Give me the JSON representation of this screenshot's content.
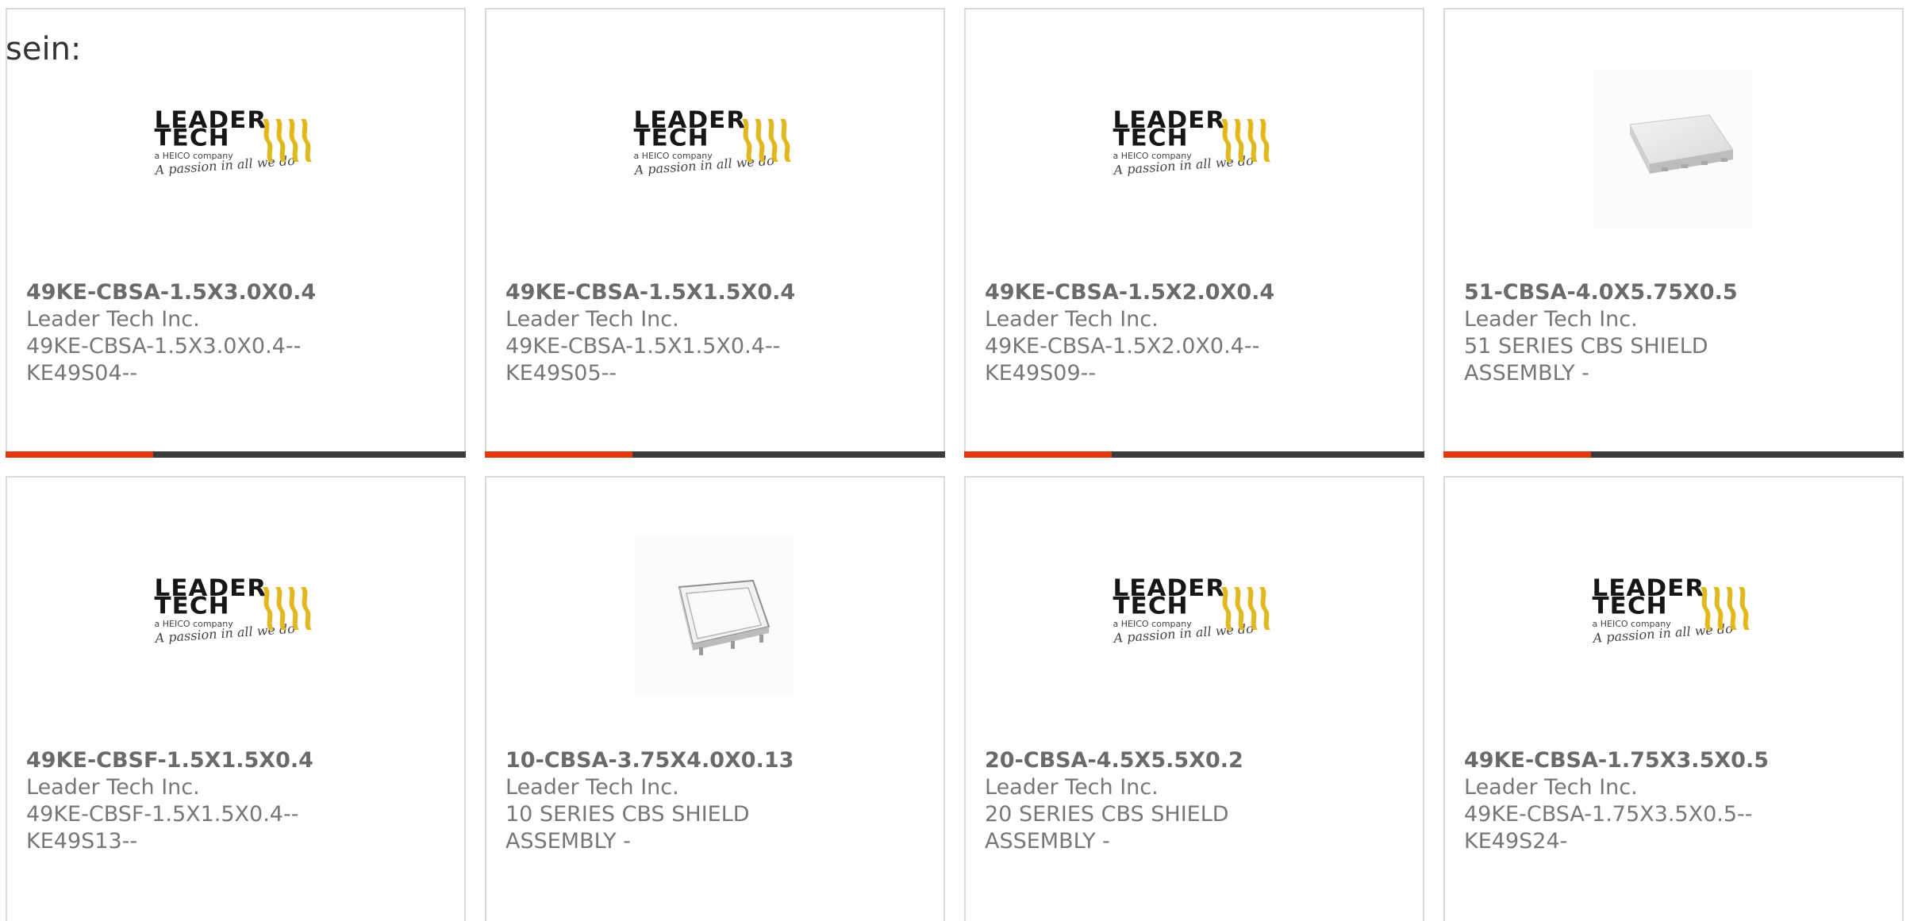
{
  "intro": {
    "text": "sein:"
  },
  "logo": {
    "line1": "LEADER",
    "line2": "TECH",
    "sub": "a HEICO company",
    "tagline": "A passion in all we do"
  },
  "products": [
    {
      "part_number": "49KE-CBSA-1.5X3.0X0.4",
      "manufacturer": "Leader Tech Inc.",
      "desc1": "49KE-CBSA-1.5X3.0X0.4--",
      "desc2": "KE49S04--",
      "image": "leader-tech-logo",
      "progress": 0.32
    },
    {
      "part_number": "49KE-CBSA-1.5X1.5X0.4",
      "manufacturer": "Leader Tech Inc.",
      "desc1": "49KE-CBSA-1.5X1.5X0.4--",
      "desc2": "KE49S05--",
      "image": "leader-tech-logo",
      "progress": 0.32
    },
    {
      "part_number": "49KE-CBSA-1.5X2.0X0.4",
      "manufacturer": "Leader Tech Inc.",
      "desc1": "49KE-CBSA-1.5X2.0X0.4--",
      "desc2": "KE49S09--",
      "image": "leader-tech-logo",
      "progress": 0.32
    },
    {
      "part_number": "51-CBSA-4.0X5.75X0.5",
      "manufacturer": "Leader Tech Inc.",
      "desc1": "51 SERIES CBS SHIELD",
      "desc2": "ASSEMBLY -",
      "image": "shield-photo-flat",
      "progress": 0.32
    },
    {
      "part_number": "49KE-CBSF-1.5X1.5X0.4",
      "manufacturer": "Leader Tech Inc.",
      "desc1": "49KE-CBSF-1.5X1.5X0.4--",
      "desc2": "KE49S13--",
      "image": "leader-tech-logo"
    },
    {
      "part_number": "10-CBSA-3.75X4.0X0.13",
      "manufacturer": "Leader Tech Inc.",
      "desc1": "10 SERIES CBS SHIELD",
      "desc2": "ASSEMBLY -",
      "image": "shield-photo-frame"
    },
    {
      "part_number": "20-CBSA-4.5X5.5X0.2",
      "manufacturer": "Leader Tech Inc.",
      "desc1": "20 SERIES CBS SHIELD",
      "desc2": "ASSEMBLY -",
      "image": "leader-tech-logo"
    },
    {
      "part_number": "49KE-CBSA-1.75X3.5X0.5",
      "manufacturer": "Leader Tech Inc.",
      "desc1": "49KE-CBSA-1.75X3.5X0.5--",
      "desc2": "KE49S24-",
      "image": "leader-tech-logo"
    }
  ],
  "colors": {
    "accent": "#e03a10",
    "track": "#3b3b3b",
    "logo_yellow": "#e2b81c",
    "text": "#777777"
  }
}
